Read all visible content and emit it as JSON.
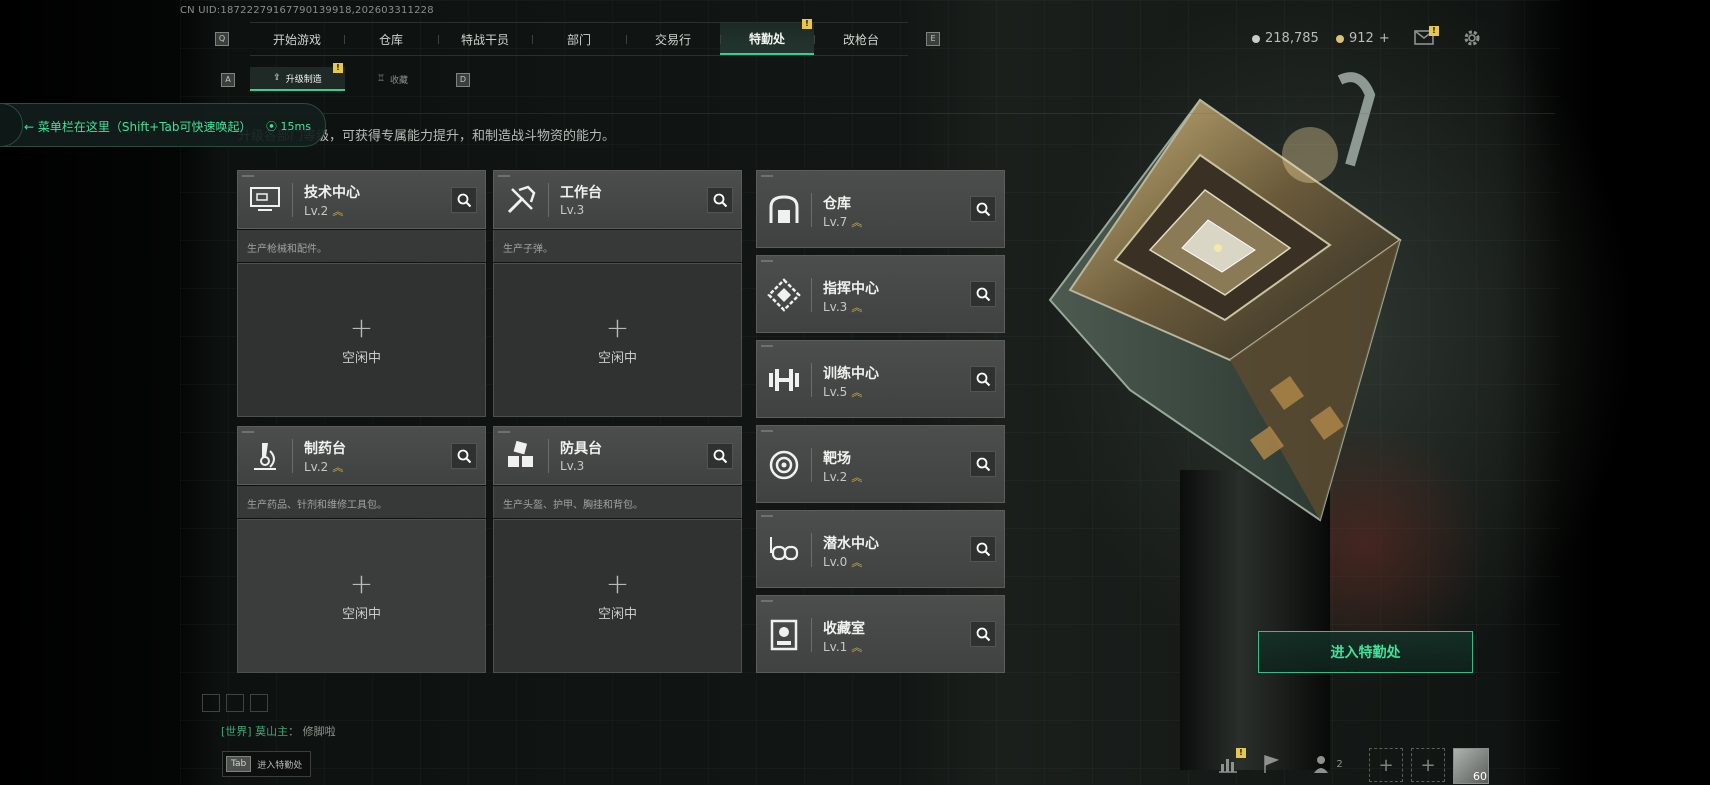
{
  "uid_text": "CN UID:18722279167790139918,202603311228",
  "nav": {
    "items": [
      {
        "label": "开始游戏"
      },
      {
        "label": "仓库"
      },
      {
        "label": "特战干员"
      },
      {
        "label": "部门"
      },
      {
        "label": "交易行"
      },
      {
        "label": "特勤处",
        "active": true,
        "badge": "!"
      },
      {
        "label": "改枪台"
      }
    ],
    "left_key": "Q",
    "right_key": "E"
  },
  "currency": {
    "silver": "218,785",
    "gold": "912",
    "gold_add": "+"
  },
  "subnav": {
    "left_key": "A",
    "right_key": "D",
    "items": [
      {
        "label": "升级制造",
        "active": true,
        "badge": "!"
      },
      {
        "label": "收藏"
      }
    ]
  },
  "tooltip": {
    "text": "菜单栏在这里（Shift+Tab可快速唤起）",
    "ping": "15ms"
  },
  "description": "升级各部门等级，可获得专属能力提升，和制造战斗物资的能力。",
  "facilities_large": [
    {
      "name": "技术中心",
      "level": "Lv.2",
      "upgradable": true,
      "desc": "生产枪械和配件。",
      "status": "空闲中",
      "icon": "monitor-icon"
    },
    {
      "name": "工作台",
      "level": "Lv.3",
      "upgradable": false,
      "desc": "生产子弹。",
      "status": "空闲中",
      "icon": "tools-icon"
    },
    {
      "name": "制药台",
      "level": "Lv.2",
      "upgradable": true,
      "desc": "生产药品、针剂和维修工具包。",
      "status": "空闲中",
      "icon": "microscope-icon"
    },
    {
      "name": "防具台",
      "level": "Lv.3",
      "upgradable": false,
      "desc": "生产头盔、护甲、胸挂和背包。",
      "status": "空闲中",
      "icon": "cubes-icon"
    }
  ],
  "facilities_small": [
    {
      "name": "仓库",
      "level": "Lv.7",
      "upgradable": true,
      "icon": "vault-icon"
    },
    {
      "name": "指挥中心",
      "level": "Lv.3",
      "upgradable": true,
      "icon": "command-icon"
    },
    {
      "name": "训练中心",
      "level": "Lv.5",
      "upgradable": true,
      "icon": "dumbbell-icon"
    },
    {
      "name": "靶场",
      "level": "Lv.2",
      "upgradable": true,
      "icon": "target-icon"
    },
    {
      "name": "潜水中心",
      "level": "Lv.0",
      "upgradable": true,
      "icon": "diving-mask-icon"
    },
    {
      "name": "收藏室",
      "level": "Lv.1",
      "upgradable": true,
      "icon": "collection-icon"
    }
  ],
  "enter_button": "进入特勤处",
  "chat": {
    "channel": "[世界]",
    "user": "莫山主",
    "message": "修脚啦"
  },
  "tab_hint": {
    "key": "Tab",
    "text": "进入特勤处"
  },
  "bottom_bar": {
    "stats_badge": "!",
    "team_count": "2",
    "player_level": "60"
  },
  "colors": {
    "accent": "#2fd29b",
    "accent_text": "#3ee39a",
    "badge": "#e8c84a",
    "upgrade_chevron": "#d8b84a"
  }
}
